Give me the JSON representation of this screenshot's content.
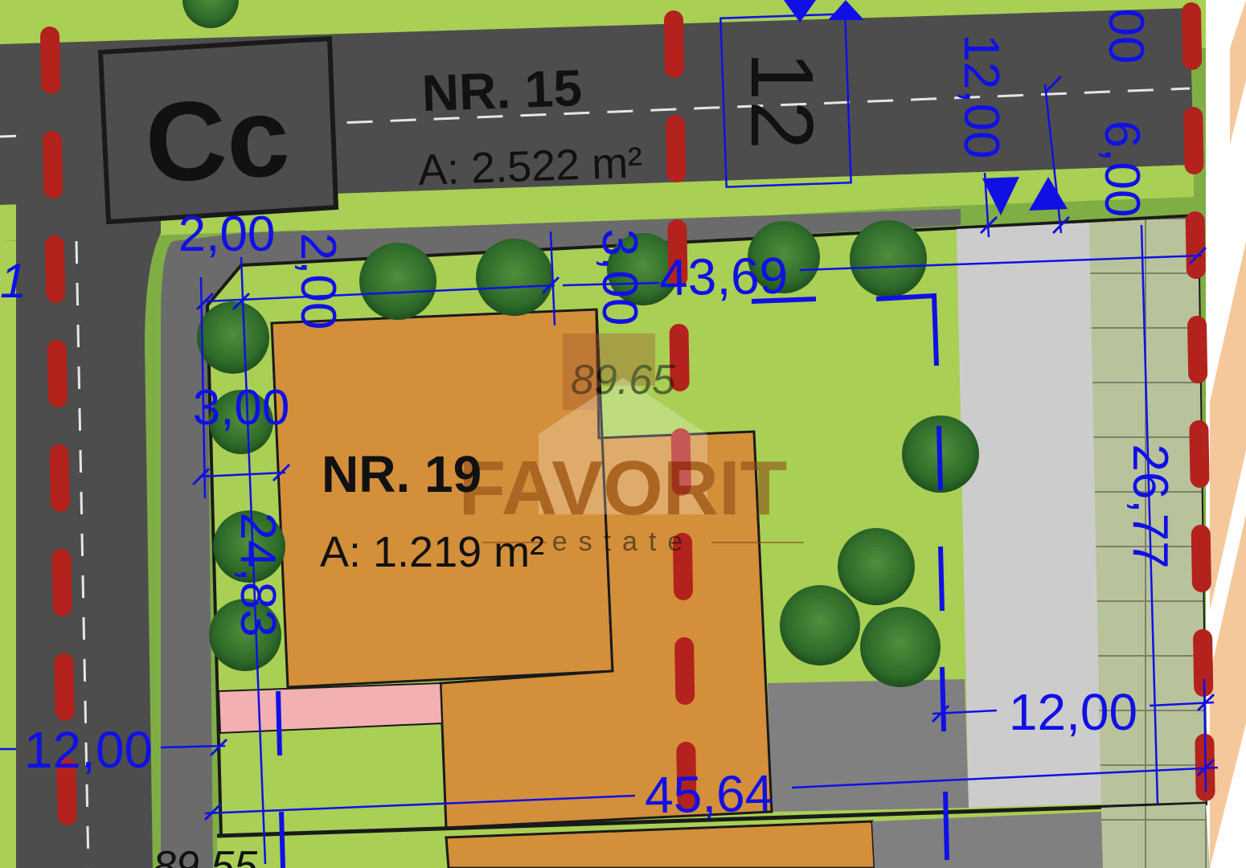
{
  "plots": {
    "street": {
      "name": "NR. 15",
      "area_label": "A: 2.522 m²"
    },
    "lot": {
      "name": "NR. 19",
      "area_label": "A: 1.219 m²"
    }
  },
  "signs": {
    "zone_code": "Cc",
    "road_number": "12"
  },
  "dimensions": {
    "top_length": "43,69",
    "bottom_length": "45,64",
    "right_height": "26,77",
    "left_height": "24,83",
    "left_setback_top": "3,00",
    "corner_offset_h": "2,00",
    "corner_offset_v": "2,00",
    "front_setback": "3,00",
    "road_width_left": "12,00",
    "road_width_top": "12,00",
    "rear_setback": "12,00",
    "partial_top_edge": "00",
    "right_strip": "6,00"
  },
  "watermark": {
    "brand": "FAVORIT",
    "subtitle": "estate",
    "price": "89.65"
  },
  "partial_labels": {
    "left_edge_fragment": "1",
    "bottom_number": "89.55"
  },
  "colors": {
    "road": "#4d4d4d",
    "grass": "#a9cf54",
    "grass_dark": "#7fae45",
    "building": "#d48f3a",
    "pavement": "#cccccc",
    "paving_grid": "#b8c39b",
    "zone_boundary": "#b3221d",
    "dimension_lines": "#1010e6",
    "trees": "#2e6b2a",
    "pink_strip": "#f2b0b0",
    "gray_lot": "#808080",
    "orange_strip": "#f5c89b"
  }
}
